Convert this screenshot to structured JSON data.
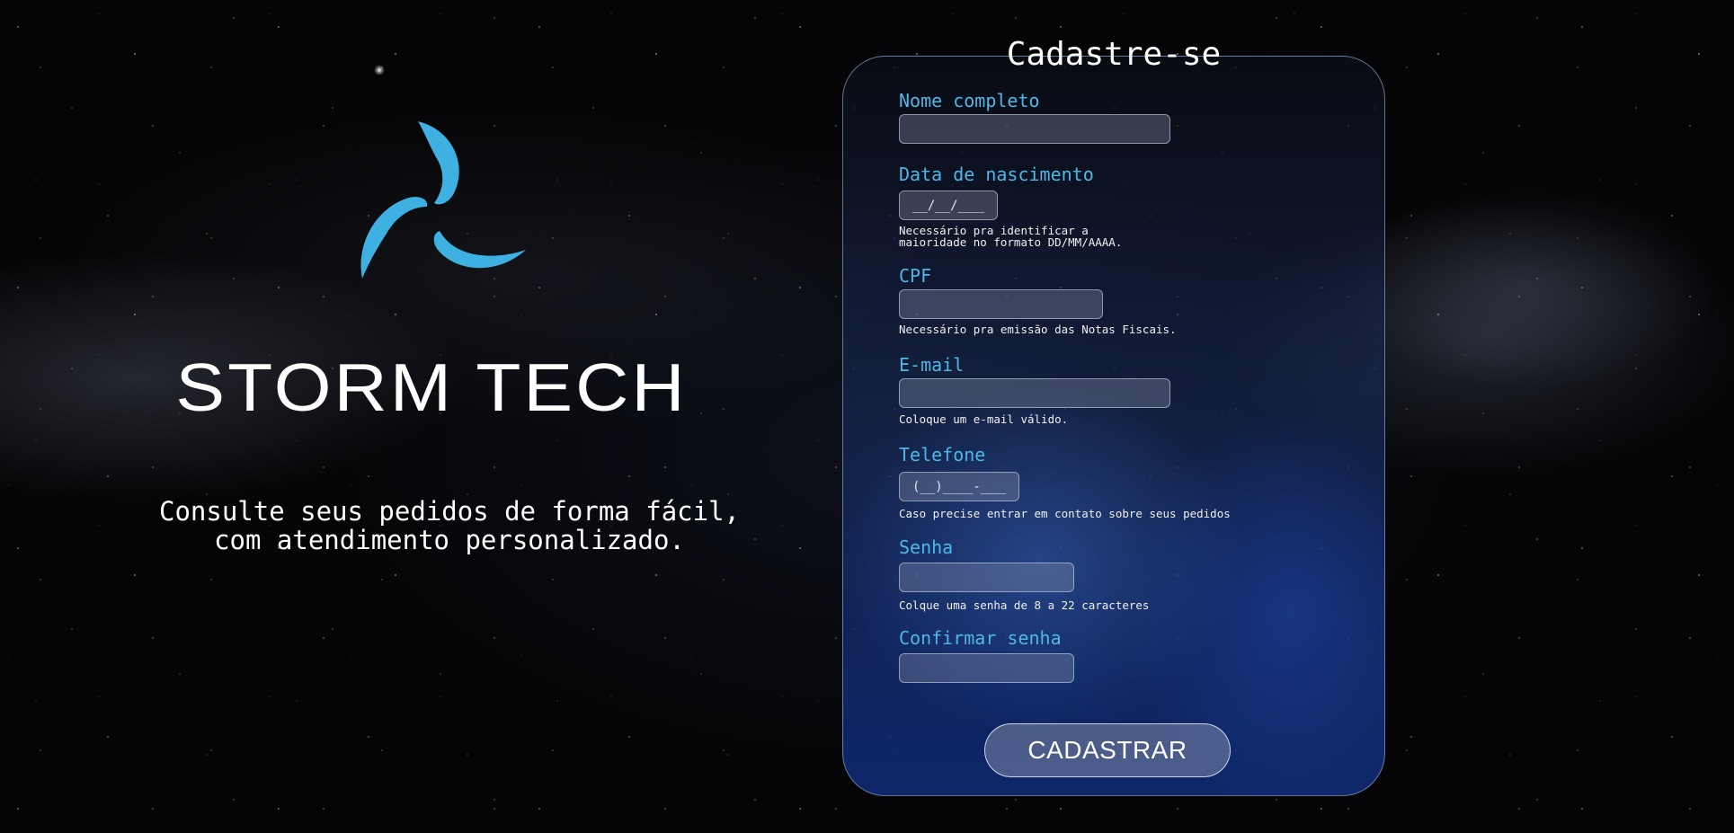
{
  "brand": {
    "logo_icon": "storm-swirl-icon",
    "name": "STORM TECH",
    "tagline": "Consulte seus pedidos de forma fácil,\ncom atendimento personalizado.",
    "accent_color": "#4fb7e6"
  },
  "form": {
    "title": "Cadastre-se",
    "fields": [
      {
        "label": "Nome completo",
        "value": "",
        "placeholder": "",
        "hint": ""
      },
      {
        "label": "Data de nascimento",
        "value": "",
        "placeholder": "__/__/____",
        "hint": "Necessário pra identificar a\nmaioridade no formato DD/MM/AAAA."
      },
      {
        "label": "CPF",
        "value": "",
        "placeholder": "",
        "hint": "Necessário pra emissão das Notas Fiscais."
      },
      {
        "label": "E-mail",
        "value": "",
        "placeholder": "",
        "hint": "Coloque um e-mail válido."
      },
      {
        "label": "Telefone",
        "value": "",
        "placeholder": "(__)____-____",
        "hint": "Caso precise entrar em contato sobre seus pedidos"
      },
      {
        "label": "Senha",
        "value": "",
        "placeholder": "",
        "hint": "Colque uma senha de 8 a 22 caracteres"
      },
      {
        "label": "Confirmar senha",
        "value": "",
        "placeholder": "",
        "hint": ""
      }
    ],
    "submit_label": "CADASTRAR"
  }
}
